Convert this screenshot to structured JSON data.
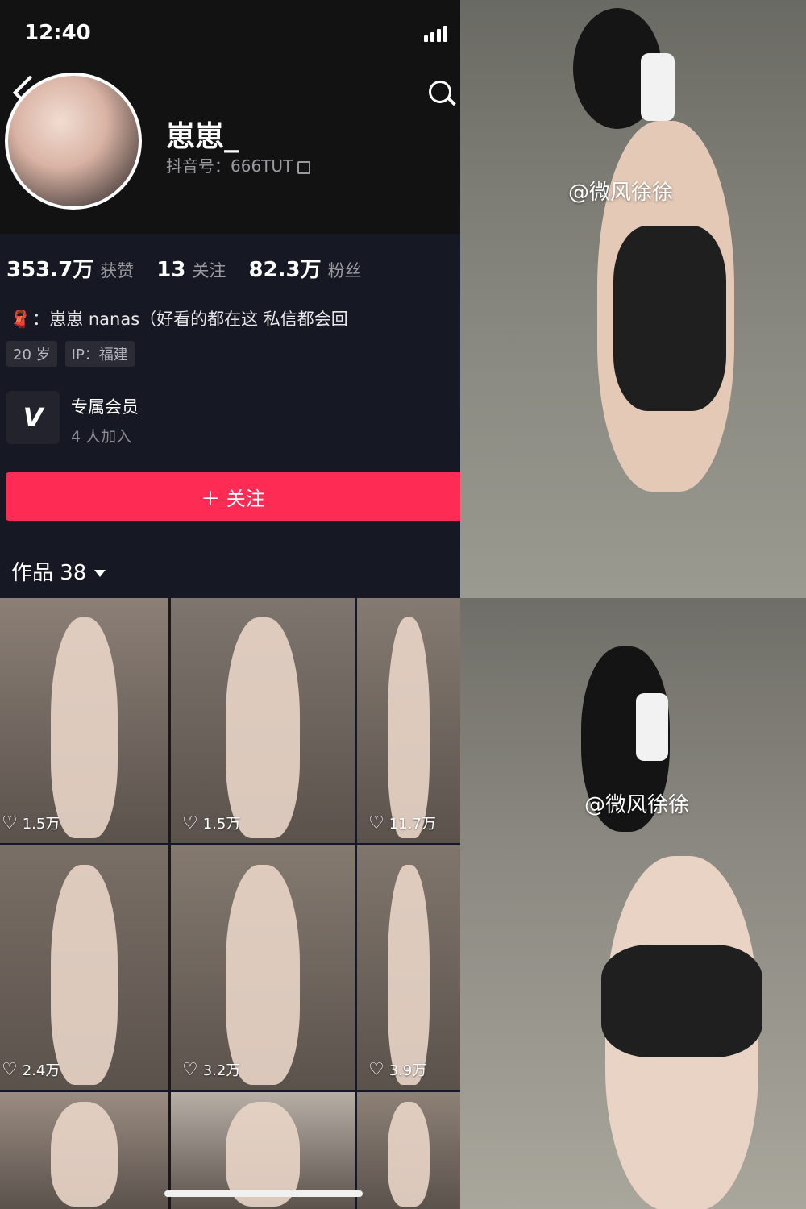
{
  "status_bar": {
    "time": "12:40"
  },
  "profile": {
    "username": "崽崽_",
    "douyin_id": "抖音号：666TUT",
    "stats": [
      {
        "value": "353.7万",
        "label": "获赞"
      },
      {
        "value": "13",
        "label": "关注"
      },
      {
        "value": "82.3万",
        "label": "粉丝"
      }
    ],
    "bio": "：崽崽 nanas（好看的都在这 私信都会回",
    "tags": [
      "20 岁",
      "IP：福建"
    ],
    "member": {
      "title": "专属会员",
      "subtitle": "4 人加入"
    },
    "follow_button": "＋ 关注"
  },
  "works": {
    "title": "作品 38",
    "items": [
      {
        "likes": "1.5万",
        "bg": "#8b7f76"
      },
      {
        "likes": "1.5万",
        "bg": "#7e756e"
      },
      {
        "likes": "11.7万",
        "bg": "#857b72"
      },
      {
        "likes": "2.4万",
        "bg": "#7a6f66"
      },
      {
        "likes": "3.2万",
        "bg": "#847a70"
      },
      {
        "likes": "3.9万",
        "bg": "#80766d"
      },
      {
        "likes": "",
        "bg": "#9a8c82"
      },
      {
        "likes": "",
        "bg": "#b7aea6"
      },
      {
        "likes": "",
        "bg": "#8d8177"
      }
    ]
  },
  "right_photos": {
    "top_watermark": "@微风徐徐",
    "bottom_watermark": "@微风徐徐"
  },
  "colors": {
    "accent": "#fe2c55",
    "background": "#161823"
  }
}
